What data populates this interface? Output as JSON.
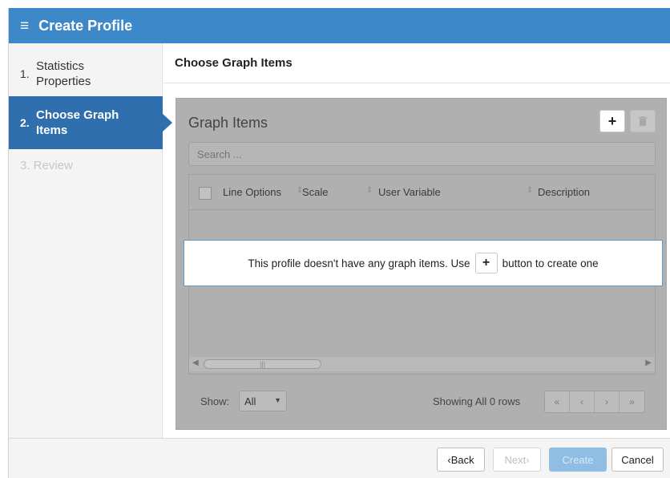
{
  "title_bar": {
    "menu_icon": "hamburger-icon",
    "title": "Create Profile"
  },
  "steps": [
    {
      "number": "1.",
      "label": "Statistics Properties",
      "state": "done"
    },
    {
      "number": "2.",
      "label": "Choose Graph Items",
      "state": "active"
    },
    {
      "number": "",
      "label": "3. Review",
      "state": "pending"
    }
  ],
  "main": {
    "heading": "Choose Graph Items",
    "panel": {
      "title": "Graph Items",
      "add_icon": "+",
      "delete_icon": "trash-icon",
      "search_placeholder": "Search ...",
      "columns": [
        "Line Options",
        "Scale",
        "User Variable",
        "Description"
      ],
      "rows": [],
      "empty_text_before": "This profile doesn't have any graph items. Use",
      "empty_button": "+",
      "empty_text_after": "button to create one",
      "scrollbar_grip": "|||",
      "show_label": "Show:",
      "show_value": "All",
      "rows_info": "Showing All 0 rows",
      "pager": [
        "«",
        "‹",
        "›",
        "»"
      ]
    }
  },
  "footer": {
    "back": "‹Back",
    "next": "Next›",
    "create": "Create",
    "cancel": "Cancel"
  },
  "colors": {
    "brand_blue": "#3d88c8",
    "active_step": "#2f6fad",
    "overlay_gray": "#b0b0b0"
  }
}
